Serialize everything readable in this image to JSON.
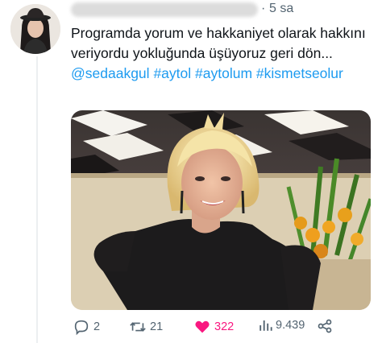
{
  "tweet": {
    "time": "5 sa",
    "separator": "·",
    "text_plain_1": "Programda yorum ve hakkaniyet olarak hakkını veriyordu yokluğunda üşüyoruz geri dön... ",
    "mentions": [
      "@sedaakgul",
      "#aytol",
      "#aytolum",
      "#kismetseolur"
    ],
    "actions": {
      "replies": "2",
      "retweets": "21",
      "likes": "322",
      "views": "9.439"
    },
    "colors": {
      "link": "#1d9bf0",
      "like": "#f91880",
      "muted": "#536471"
    },
    "icons": [
      "reply-icon",
      "retweet-icon",
      "like-icon",
      "views-icon",
      "share-icon"
    ]
  }
}
